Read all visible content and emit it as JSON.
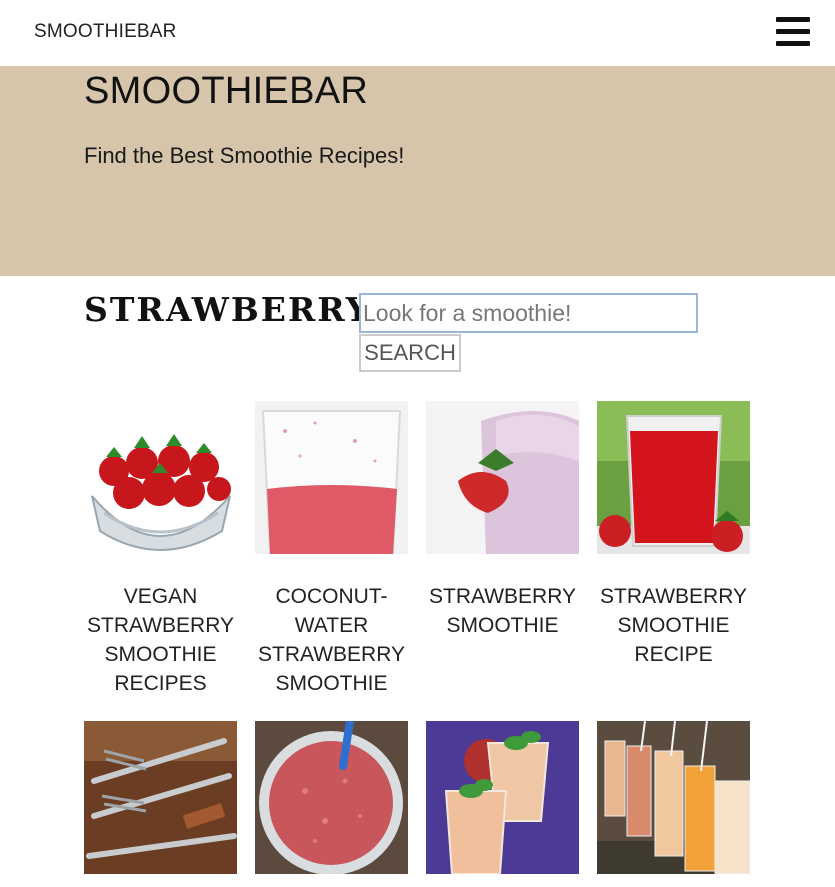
{
  "header": {
    "brand": "SMOOTHIEBAR",
    "menu_icon": "hamburger-menu-icon"
  },
  "hero": {
    "title": "SMOOTHIEBAR",
    "subtitle": "Find the Best Smoothie Recipes!",
    "background": "#d6c5ab"
  },
  "section": {
    "title": "STRAWBERRY"
  },
  "search": {
    "placeholder": "Look for a smoothie!",
    "value": "",
    "button_label": "SEARCH"
  },
  "recipes": [
    {
      "title": "VEGAN STRAWBERRY SMOOTHIE RECIPES",
      "image": "strawberries-in-glass-bowl"
    },
    {
      "title": "COCONUT-WATER STRAWBERRY SMOOTHIE",
      "image": "half-filled-glass"
    },
    {
      "title": "STRAWBERRY SMOOTHIE",
      "image": "pink-smoothie-with-strawberry"
    },
    {
      "title": "STRAWBERRY SMOOTHIE RECIPE",
      "image": "red-smoothie-glass"
    },
    {
      "title": "",
      "image": "forks-and-knives"
    },
    {
      "title": "",
      "image": "red-smoothie-with-straw"
    },
    {
      "title": "",
      "image": "peach-smoothies-with-mint"
    },
    {
      "title": "",
      "image": "row-of-smoothie-glasses"
    }
  ]
}
